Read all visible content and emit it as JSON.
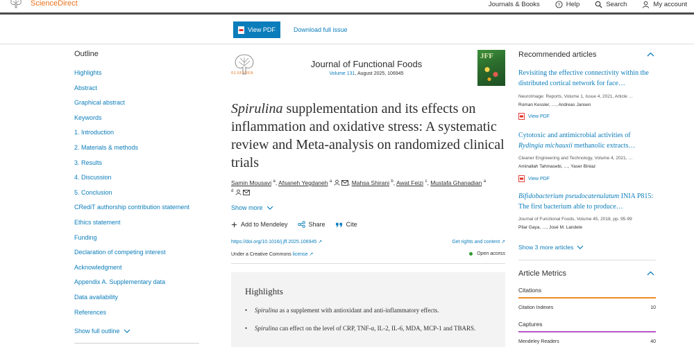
{
  "topbar": {
    "brand": "ScienceDirect",
    "nav": [
      {
        "label": "Journals & Books",
        "icon": "none"
      },
      {
        "label": "Help",
        "icon": "help-circle-icon"
      },
      {
        "label": "Search",
        "icon": "search-icon"
      },
      {
        "label": "My account",
        "icon": "user-icon"
      }
    ]
  },
  "actions": {
    "view_pdf": "View PDF",
    "download_issue": "Download full issue"
  },
  "outline": {
    "title": "Outline",
    "items": [
      "Highlights",
      "Abstract",
      "Graphical abstract",
      "Keywords",
      "1. Introduction",
      "2. Materials & methods",
      "3. Results",
      "4. Discussion",
      "5. Conclusion",
      "CRediT authorship contribution statement",
      "Ethics statement",
      "Funding",
      "Declaration of competing interest",
      "Acknowledgment",
      "Appendix A. Supplementary data",
      "Data availability",
      "References"
    ],
    "show_full": "Show full outline"
  },
  "article": {
    "publisher": "ELSEVIER",
    "journal": "Journal of Functional Foods",
    "volume_link": "Volume 131",
    "volume_rest": ", August 2025, 106945",
    "cover_text": "JFF",
    "title_italic": "Spirulina",
    "title_rest": " supplementation and its effects on inflammation and oxidative stress: A systematic review and Meta-analysis on randomized clinical trials",
    "authors": [
      {
        "name": "Samin Mousavi",
        "sup": "a"
      },
      {
        "name": "Afsaneh Yegdaneh",
        "sup": "a"
      },
      {
        "name": "Mahsa Shirani",
        "sup": "b"
      },
      {
        "name": "Awat Feizi",
        "sup": "c"
      },
      {
        "name": "Mustafa Ghanadian",
        "sup": "a"
      }
    ],
    "last_sup": "d",
    "show_more": "Show more",
    "tools": {
      "add_mendeley": "Add to Mendeley",
      "share": "Share",
      "cite": "Cite"
    },
    "doi": "https://doi.org/10.1016/j.jff.2025.106945 ↗",
    "rights": "Get rights and content ↗",
    "license_prefix": "Under a Creative Commons ",
    "license_link": "license ↗",
    "open_access": "Open access"
  },
  "highlights": {
    "heading": "Highlights",
    "items": [
      {
        "italic": "Spirulina",
        "rest": " as a supplement with antioxidant and anti-inflammatory effects."
      },
      {
        "italic": "Spirulina",
        "rest": " can effect on the level of CRP, TNF-α, IL-2, IL-6, MDA, MCP-1 and TBARS."
      }
    ]
  },
  "recommended": {
    "heading": "Recommended articles",
    "articles": [
      {
        "title": "Revisiting the effective connectivity within the distributed cortical network for face…",
        "title_italic": "",
        "meta": "NeuroImage: Reports, Volume 1, Issue 4, 2021, Article …",
        "authors": "Roman Kessler, …, Andreas Jansen",
        "pdf": "View PDF"
      },
      {
        "title_pre": "Cytotoxic and antimicrobial activities of ",
        "title_italic": "Rydingia michauxii",
        "title_post": " methanolic extracts…",
        "meta": "Cleaner Engineering and Technology, Volume 4, 2021, …",
        "authors": "Aminallah Tahmasebi, …, Yaser Biniaz",
        "pdf": "View PDF"
      },
      {
        "title_italic": "Bifidobacterium pseudocatenulatum",
        "title_post": " INIA P815: The first bacterium able to produce…",
        "meta": "Journal of Functional Foods, Volume 45, 2018, pp. 95-99",
        "authors": "Pilar Gaya, …, José M. Landete"
      }
    ],
    "show_more": "Show 3 more articles"
  },
  "metrics": {
    "heading": "Article Metrics",
    "citations_label": "Citations",
    "citation_indexes_label": "Citation Indexes",
    "citation_indexes_value": "10",
    "captures_label": "Captures",
    "mendeley_label": "Mendeley Readers",
    "mendeley_value": "40",
    "citations_color": "#f08a24",
    "captures_color": "#b556c5"
  },
  "colors": {
    "link": "#0c7dbb",
    "brand_orange": "#e9711c"
  }
}
